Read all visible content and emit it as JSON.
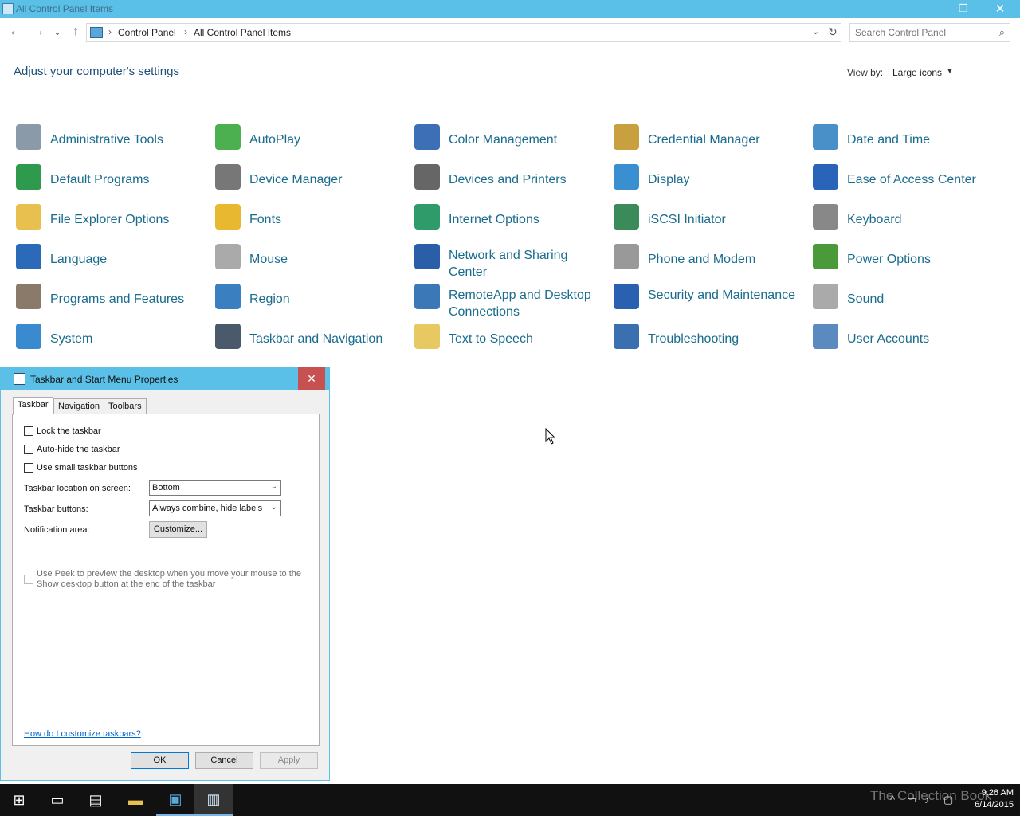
{
  "window": {
    "title": "All Control Panel Items",
    "minimize": "—",
    "maximize": "❐",
    "close": "✕"
  },
  "nav": {
    "back": "←",
    "forward": "→",
    "recent": "⌄",
    "up": "↑",
    "breadcrumb": [
      "Control Panel",
      "All Control Panel Items"
    ],
    "search_placeholder": "Search Control Panel"
  },
  "main": {
    "heading": "Adjust your computer's settings",
    "view_by_label": "View by:",
    "view_by_value": "Large icons"
  },
  "items": [
    {
      "label": "Administrative Tools",
      "color": "#8a9aa8"
    },
    {
      "label": "AutoPlay",
      "color": "#4caf50"
    },
    {
      "label": "Color Management",
      "color": "#3d6fb6"
    },
    {
      "label": "Credential Manager",
      "color": "#c8a040"
    },
    {
      "label": "Date and Time",
      "color": "#4a90c8"
    },
    {
      "label": "Default Programs",
      "color": "#2e9a4e"
    },
    {
      "label": "Device Manager",
      "color": "#777777"
    },
    {
      "label": "Devices and Printers",
      "color": "#666666"
    },
    {
      "label": "Display",
      "color": "#3a8fd0"
    },
    {
      "label": "Ease of Access Center",
      "color": "#2a64b8"
    },
    {
      "label": "File Explorer Options",
      "color": "#e8c050"
    },
    {
      "label": "Fonts",
      "color": "#e8b830"
    },
    {
      "label": "Internet Options",
      "color": "#2f9a6a"
    },
    {
      "label": "iSCSI Initiator",
      "color": "#3a8a5a"
    },
    {
      "label": "Keyboard",
      "color": "#888888"
    },
    {
      "label": "Language",
      "color": "#2a6ab8"
    },
    {
      "label": "Mouse",
      "color": "#aaaaaa"
    },
    {
      "label": "Network and Sharing Center",
      "color": "#2a5ea8"
    },
    {
      "label": "Phone and Modem",
      "color": "#999999"
    },
    {
      "label": "Power Options",
      "color": "#4a9a3a"
    },
    {
      "label": "Programs and Features",
      "color": "#8a7a6a"
    },
    {
      "label": "Region",
      "color": "#3a80c0"
    },
    {
      "label": "RemoteApp and Desktop Connections",
      "color": "#3a78b8"
    },
    {
      "label": "Security and Maintenance",
      "color": "#2a60b0"
    },
    {
      "label": "Sound",
      "color": "#aaaaaa"
    },
    {
      "label": "System",
      "color": "#3a8ad0"
    },
    {
      "label": "Taskbar and Navigation",
      "color": "#4a5a6a"
    },
    {
      "label": "Text to Speech",
      "color": "#e8c860"
    },
    {
      "label": "Troubleshooting",
      "color": "#3a70b0"
    },
    {
      "label": "User Accounts",
      "color": "#5a8ac0"
    }
  ],
  "dialog": {
    "title": "Taskbar and Start Menu Properties",
    "close": "✕",
    "tabs": [
      "Taskbar",
      "Navigation",
      "Toolbars"
    ],
    "checkboxes": {
      "lock": "Lock the taskbar",
      "autohide": "Auto-hide the taskbar",
      "small": "Use small taskbar buttons",
      "peek": "Use Peek to preview the desktop when you move your mouse to the Show desktop button at the end of the taskbar"
    },
    "location_label": "Taskbar location on screen:",
    "location_value": "Bottom",
    "buttons_label": "Taskbar buttons:",
    "buttons_value": "Always combine, hide labels",
    "notification_label": "Notification area:",
    "customize": "Customize...",
    "help_link": "How do I customize taskbars?",
    "ok": "OK",
    "cancel": "Cancel",
    "apply": "Apply"
  },
  "taskbar": {
    "watermark": "The Collection Book",
    "time": "9:26 AM",
    "date": "6/14/2015"
  }
}
